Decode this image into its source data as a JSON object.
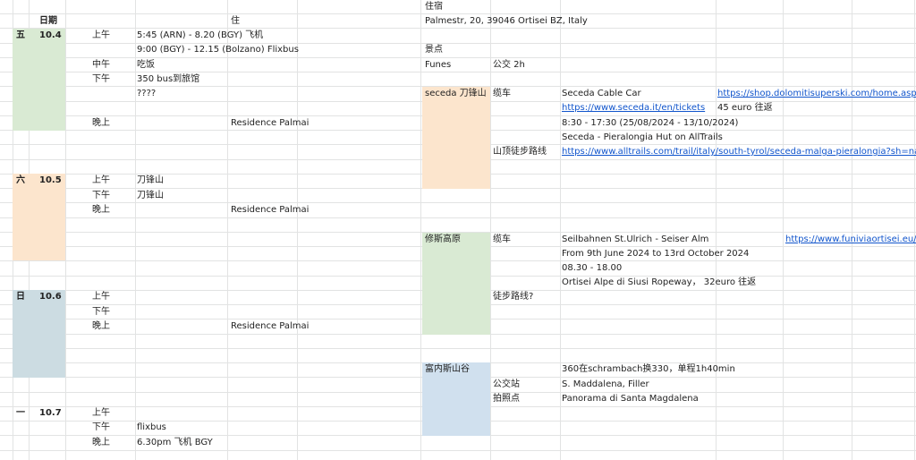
{
  "colors": {
    "green": "#d9ead3",
    "orange": "#fce5cd",
    "blue": "#d0e0ee",
    "steel": "#ccdce2",
    "gridline": "#e2e3e3",
    "link": "#1155cc"
  },
  "header": {
    "date": "日期",
    "stay": "住",
    "lodging": "住宿"
  },
  "days": [
    {
      "weekday": "五",
      "date": "10.4"
    },
    {
      "weekday": "六",
      "date": "10.5"
    },
    {
      "weekday": "日",
      "date": "10.6"
    },
    {
      "weekday": "一",
      "date": "10.7"
    }
  ],
  "schedule": {
    "d1": {
      "morning": "上午",
      "m1": "5:45 (ARN) - 8.20 (BGY) 飞机",
      "m2": "9:00 (BGY) - 12.15 (Bolzano) Flixbus",
      "noon": "中午",
      "noon_text": "吃饭",
      "afternoon": "下午",
      "a1": "350 bus到旅馆",
      "a2": "????",
      "evening": "晚上",
      "hotel": "Residence Palmai"
    },
    "d2": {
      "morning": "上午",
      "m1": "刀锋山",
      "afternoon": "下午",
      "a1": "刀锋山",
      "evening": "晚上",
      "hotel": "Residence Palmai"
    },
    "d3": {
      "morning": "上午",
      "afternoon": "下午",
      "evening": "晚上",
      "hotel": "Residence Palmai"
    },
    "d4": {
      "morning": "上午",
      "afternoon": "下午",
      "a1": "flixbus",
      "evening": "晚上",
      "e1": "6.30pm 飞机 BGY"
    }
  },
  "right": {
    "address": "Palmestr, 20, 39046 Ortisei BZ, Italy",
    "sights": "景点",
    "funes": "Funes",
    "funes_bus": "公交 2h",
    "seceda": {
      "name": "seceda 刀锋山",
      "cable": "缆车",
      "cable_name": "Seceda Cable Car",
      "shop_link": "https://shop.dolomitisuperski.com/home.aspx",
      "tickets_link": "https://www.seceda.it/en/tickets",
      "price": "45 euro 往返",
      "hours": "8:30 - 17:30 (25/08/2024 - 13/10/2024)",
      "trail_name": "Seceda - Pieralongia Hut on AllTrails",
      "hike": "山顶徒步路线",
      "trail_link": "https://www.alltrails.com/trail/italy/south-tyrol/seceda-malga-pieralongia?sh=na3qry"
    },
    "seiser": {
      "name": "修斯高原",
      "cable": "缆车",
      "cable_name": "Seilbahnen St.Ulrich - Seiser Alm",
      "link": "https://www.funiviaortisei.eu/",
      "dates": "From 9th June 2024 to 13rd October 2024",
      "hours": "08.30 - 18.00",
      "ropeway": "Ortisei Alpe di Siusi Ropeway， 32euro 往返",
      "hike": "徒步路线?"
    },
    "funes_valley": {
      "name": "富内斯山谷",
      "bus_note": "360在schrambach换330，单程1h40min",
      "stop_label": "公交站",
      "stop": "S. Maddalena, Filler",
      "photo_label": "拍照点",
      "photo": "Panorama di Santa Magdalena"
    }
  }
}
